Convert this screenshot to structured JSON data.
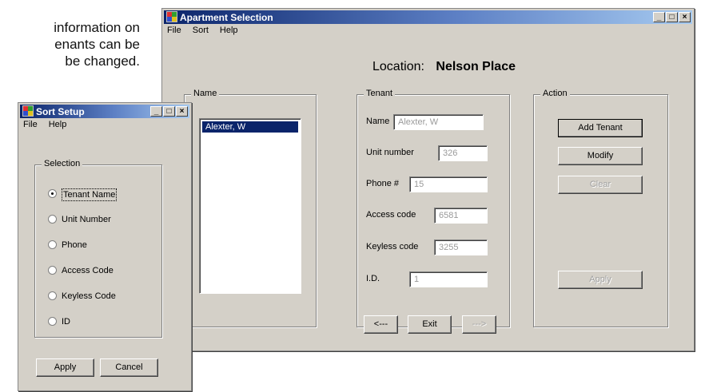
{
  "background_text": [
    "information on",
    "enants can be",
    "be changed."
  ],
  "main_window": {
    "title": "Apartment Selection",
    "controls": [
      "_",
      "□",
      "×"
    ],
    "menu": [
      "File",
      "Sort",
      "Help"
    ],
    "location_label": "Location:",
    "location_value": "Nelson Place",
    "name_group": {
      "label": "Name",
      "items": [
        "Alexter, W"
      ]
    },
    "tenant_group": {
      "label": "Tenant",
      "fields": [
        {
          "label": "Name",
          "value": "Alexter, W"
        },
        {
          "label": "Unit number",
          "value": "326"
        },
        {
          "label": "Phone #",
          "value": "15"
        },
        {
          "label": "Access code",
          "value": "6581"
        },
        {
          "label": "Keyless code",
          "value": "3255"
        },
        {
          "label": "I.D.",
          "value": "1"
        }
      ]
    },
    "action_group": {
      "label": "Action",
      "buttons": [
        "Add Tenant",
        "Modify",
        "Clear",
        "Apply"
      ]
    },
    "nav_buttons": [
      "<---",
      "Exit",
      "--->"
    ]
  },
  "sort_window": {
    "title": "Sort Setup",
    "controls": [
      "_",
      "□",
      "×"
    ],
    "menu": [
      "File",
      "Help"
    ],
    "selection_group": {
      "label": "Selection",
      "options": [
        "Tenant Name",
        "Unit Number",
        "Phone",
        "Access Code",
        "Keyless Code",
        "ID"
      ],
      "selected": "Tenant Name"
    },
    "buttons": [
      "Apply",
      "Cancel"
    ]
  }
}
